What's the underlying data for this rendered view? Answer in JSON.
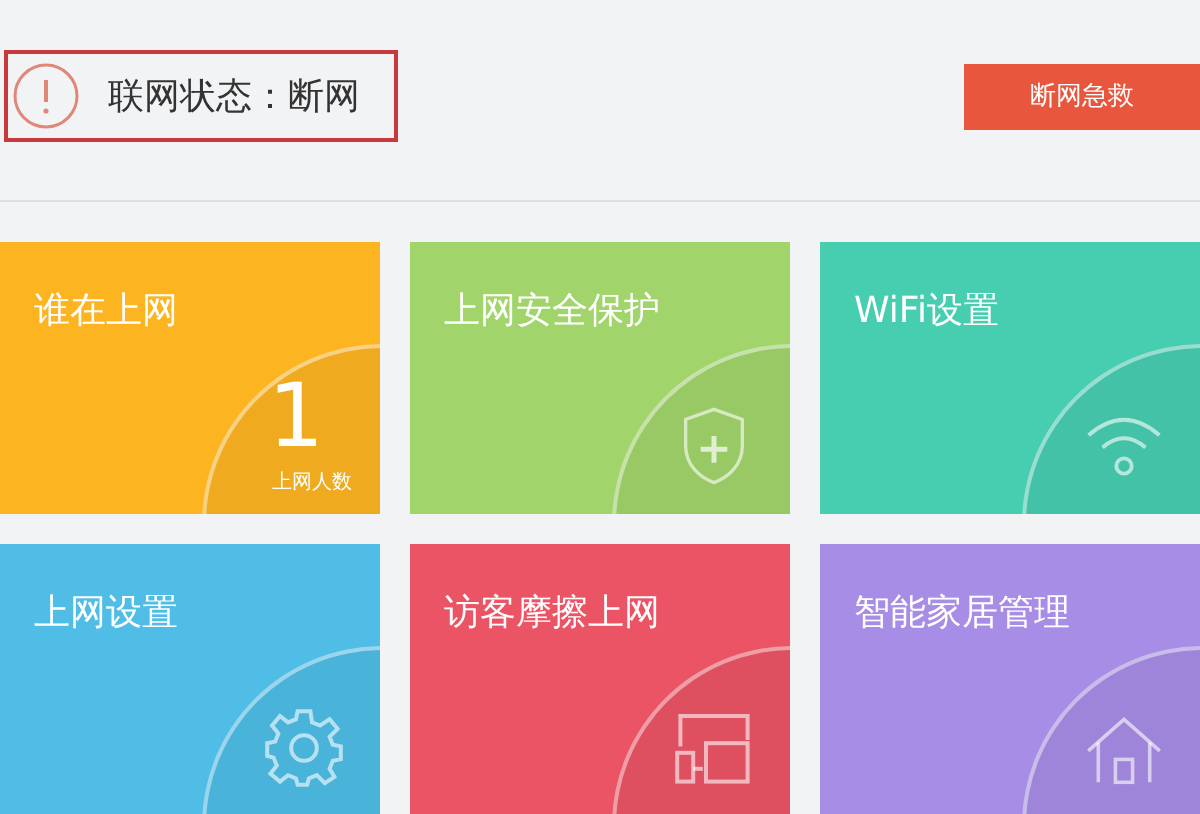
{
  "status": {
    "text": "联网状态：断网"
  },
  "rescue_button": "断网急救",
  "tiles": [
    {
      "title": "谁在上网",
      "kind": "count",
      "color": "#fdb421",
      "count": "1",
      "caption": "上网人数"
    },
    {
      "title": "上网安全保护",
      "kind": "shield",
      "color": "#a1d46a"
    },
    {
      "title": "WiFi设置",
      "kind": "wifi",
      "color": "#47cdb0"
    },
    {
      "title": "上网设置",
      "kind": "gear",
      "color": "#4fbde6"
    },
    {
      "title": "访客摩擦上网",
      "kind": "devices",
      "color": "#ea5465"
    },
    {
      "title": "智能家居管理",
      "kind": "house",
      "color": "#a78de5"
    }
  ]
}
